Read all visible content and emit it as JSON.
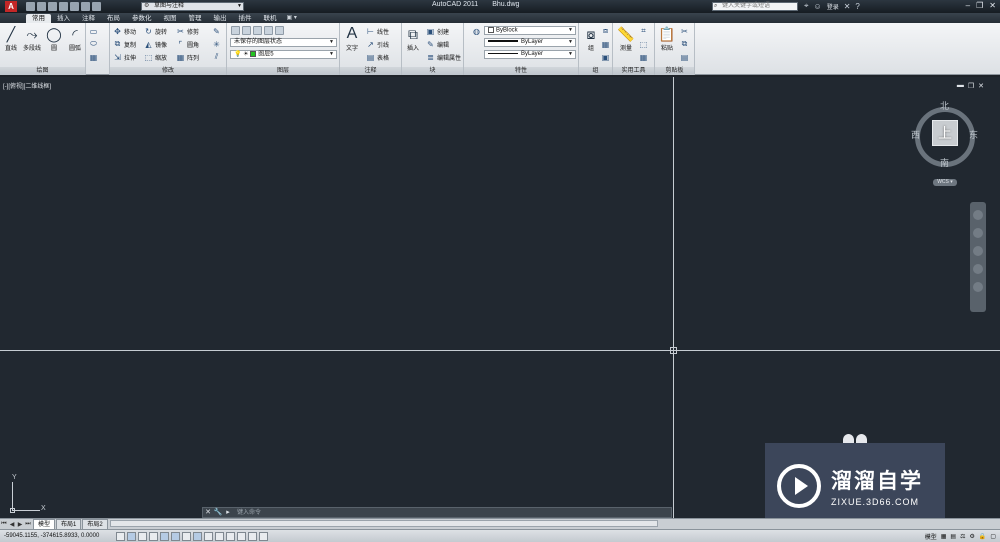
{
  "app": {
    "title": "AutoCAD 2011",
    "file": "Bhu.dwg",
    "workspace": "草图与注释",
    "help_placeholder": "键入关键字或短语",
    "login": "登录"
  },
  "tabs": [
    "常用",
    "插入",
    "注释",
    "布局",
    "参数化",
    "视图",
    "管理",
    "输出",
    "插件",
    "联机"
  ],
  "tab_extra": "▣ ▾",
  "ribbon": {
    "draw": {
      "title": "绘图",
      "line": "直线",
      "polyline": "多段线",
      "circle": "圆",
      "arc": "圆弧"
    },
    "modify": {
      "title": "修改",
      "move": "移动",
      "rotate": "旋转",
      "trim": "修剪",
      "copy": "复制",
      "mirror": "镜像",
      "fillet": "圆角",
      "stretch": "拉伸",
      "scale": "缩放",
      "array": "阵列"
    },
    "layers": {
      "title": "图层",
      "state": "未保存的图层状态",
      "current_layer": "图层5"
    },
    "annotation": {
      "title": "注释",
      "text": "文字",
      "linear": "线性",
      "leader": "引线",
      "table": "表格"
    },
    "block": {
      "title": "块",
      "insert": "插入",
      "create": "创建",
      "edit": "编辑",
      "edit_attr": "编辑属性"
    },
    "properties": {
      "title": "特性",
      "color": "ByBlock",
      "lineweight": "ByLayer",
      "linetype": "ByLayer"
    },
    "groups": {
      "title": "组",
      "group": "组"
    },
    "utilities": {
      "title": "实用工具",
      "measure": "测量"
    },
    "clipboard": {
      "title": "剪贴板",
      "paste": "粘贴"
    }
  },
  "canvas": {
    "view_label": "[-][俯视][二维线框]",
    "viewcube": {
      "north": "北",
      "south": "南",
      "east": "东",
      "west": "西",
      "face": "上",
      "wcs": "WCS ▾"
    },
    "ucs": {
      "x": "X",
      "y": "Y"
    }
  },
  "command": {
    "placeholder": "键入命令"
  },
  "layout_tabs": [
    "模型",
    "布局1",
    "布局2"
  ],
  "status": {
    "coords": "-59045.1155, -374615.8933, 0.0000",
    "model": "模型"
  },
  "watermark": {
    "cn": "溜溜自学",
    "en": "ZIXUE.3D66.COM"
  },
  "colors": {
    "canvas": "#212830",
    "accent": "#c42727",
    "watermark_bg": "#3c465a"
  }
}
